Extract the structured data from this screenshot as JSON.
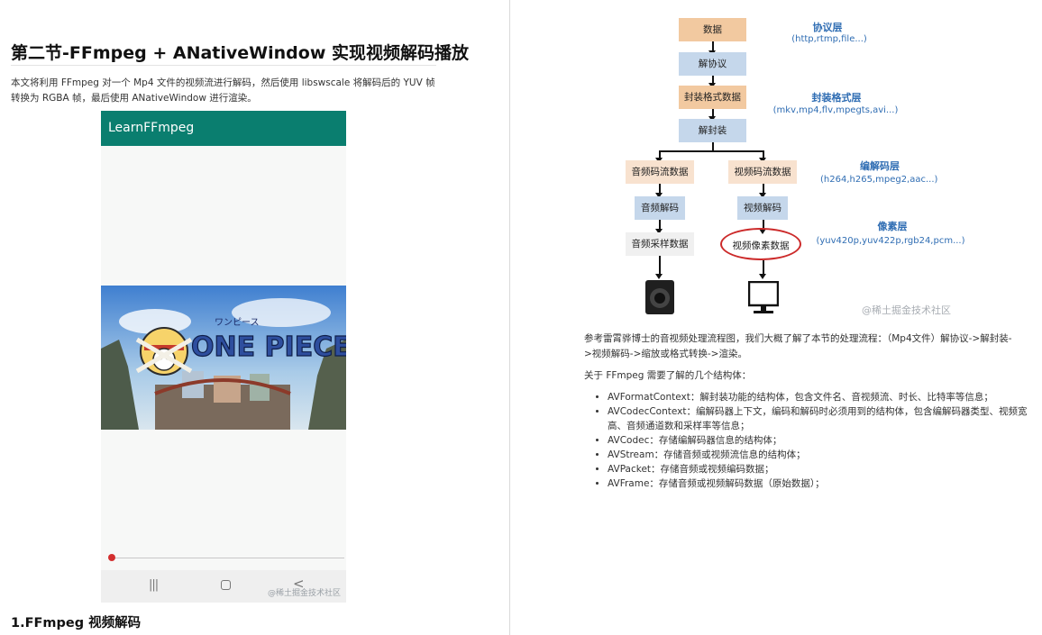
{
  "left": {
    "title": "第二节-FFmpeg + ANativeWindow 实现视频解码播放",
    "intro": "本文将利用 FFmpeg 对一个 Mp4 文件的视频流进行解码，然后使用 libswscale 将解码后的 YUV 帧转换为 RGBA 帧，最后使用 ANativeWindow 进行渲染。",
    "phone": {
      "app_title": "LearnFFmpeg",
      "video_logo": "ONE PIECE",
      "video_logo_small": "ワンピース",
      "watermark": "@稀土掘金技术社区",
      "nav_recent": "|||",
      "nav_back": "<"
    },
    "section_title": "1.FFmpeg 视频解码"
  },
  "right": {
    "diagram": {
      "boxes": {
        "data": "数据",
        "deprotocol": "解协议",
        "container_data": "封装格式数据",
        "demux": "解封装",
        "audio_stream": "音频码流数据",
        "video_stream": "视频码流数据",
        "audio_decode": "音频解码",
        "video_decode": "视频解码",
        "audio_samples": "音频采样数据",
        "video_pixels": "视频像素数据"
      },
      "layers": {
        "protocol": "协议层",
        "protocol_sub": "(http,rtmp,file...)",
        "container": "封装格式层",
        "container_sub": "(mkv,mp4,flv,mpegts,avi...)",
        "codec": "编解码层",
        "codec_sub": "(h264,h265,mpeg2,aac...)",
        "pixel": "像素层",
        "pixel_sub": "(yuv420p,yuv422p,rgb24,pcm...)"
      },
      "watermark": "@稀土掘金技术社区"
    },
    "para1": "参考雷霄骅博士的音视频处理流程图，我们大概了解了本节的处理流程：（Mp4文件）解协议->解封装->视频解码->缩放或格式转换->渲染。",
    "para2": "关于 FFmpeg 需要了解的几个结构体：",
    "structs": [
      "AVFormatContext：解封装功能的结构体，包含文件名、音视频流、时长、比特率等信息；",
      "AVCodecContext：编解码器上下文，编码和解码时必须用到的结构体，包含编解码器类型、视频宽高、音频通道数和采样率等信息；",
      "AVCodec：存储编解码器信息的结构体；",
      "AVStream：存储音频或视频流信息的结构体；",
      "AVPacket：存储音频或视频编码数据；",
      "AVFrame：存储音频或视频解码数据（原始数据）；"
    ]
  },
  "colors": {
    "appbar": "#0a7e6f",
    "progress": "#d32f2f",
    "layer_label": "#2f6db3"
  }
}
